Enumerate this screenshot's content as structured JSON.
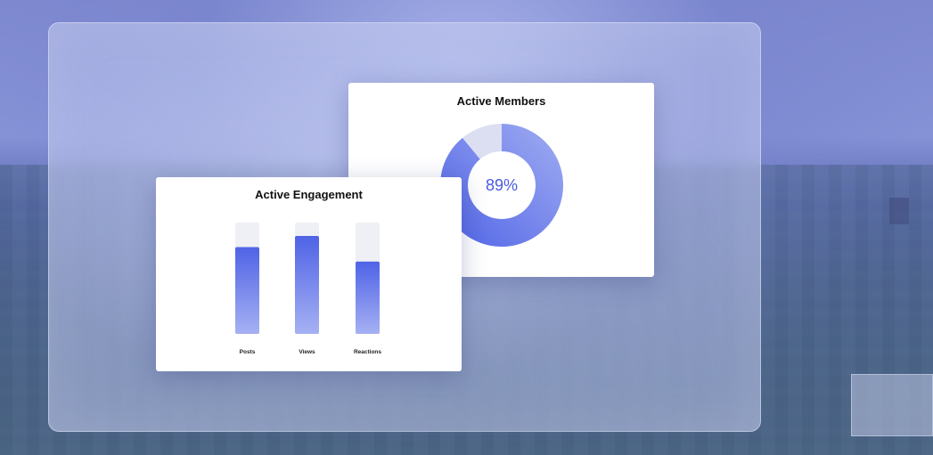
{
  "chart_data": [
    {
      "type": "pie",
      "title": "Active Members",
      "center_label": "89%",
      "segments": [
        {
          "value": 89,
          "color_start": "#a1adf2",
          "color_end": "#4f63e6"
        },
        {
          "value": 11,
          "color": "#dcdff2"
        }
      ],
      "donut": true
    },
    {
      "type": "bar",
      "title": "Active Engagement",
      "categories": [
        "Posts",
        "Views",
        "Reactions"
      ],
      "values": [
        78,
        88,
        65
      ],
      "ylim": [
        0,
        100
      ],
      "track_color": "#eef0f5",
      "bar_color_top": "#4f63e6",
      "bar_color_bottom": "#a6b1f3"
    }
  ],
  "colors": {
    "accent": "#4f63e6",
    "card_background": "#ffffff"
  }
}
